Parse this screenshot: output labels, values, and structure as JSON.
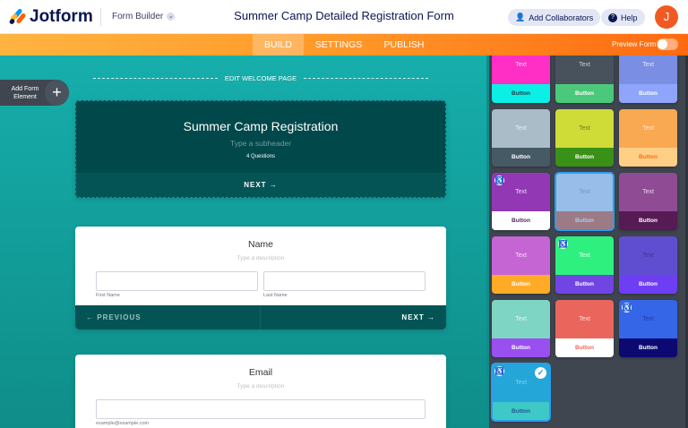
{
  "header": {
    "logo": "Jotform",
    "builder_label": "Form Builder",
    "form_title": "Summer Camp Detailed Registration Form",
    "add_collaborators": "Add Collaborators",
    "help": "Help",
    "avatar_initial": "J"
  },
  "nav": {
    "tabs": [
      {
        "label": "BUILD"
      },
      {
        "label": "SETTINGS"
      },
      {
        "label": "PUBLISH"
      }
    ],
    "active_tab": "BUILD",
    "preview_label": "Preview Form",
    "preview_on": false
  },
  "canvas": {
    "add_element": "Add Form Element",
    "add_icon": "+",
    "edit_welcome": "EDIT WELCOME PAGE",
    "welcome": {
      "title": "Summer Camp Registration",
      "subheader": "Type a subheader",
      "questions": "4 Questions",
      "next": "NEXT"
    },
    "name_q": {
      "title": "Name",
      "description": "Type a description",
      "first": "First Name",
      "last": "Last Name",
      "previous": "PREVIOUS",
      "next": "NEXT"
    },
    "email_q": {
      "title": "Email",
      "description": "Type a description",
      "sublabel": "example@example.com"
    }
  },
  "themes": [
    {
      "text": "Text",
      "button": "Button",
      "top": "#ff2ec4",
      "tc": "#ffd6f3",
      "btn": "#0bf0e6",
      "bc": "#1e3a4a"
    },
    {
      "text": "Text",
      "button": "Button",
      "top": "#48525c",
      "tc": "#c9ced4",
      "btn": "#4bc97b",
      "bc": "#ffffff"
    },
    {
      "text": "Text",
      "button": "Button",
      "top": "#7a8ee3",
      "tc": "#e3e8ff",
      "btn": "#8fa5fb",
      "bc": "#ffffff"
    },
    {
      "text": "Text",
      "button": "Button",
      "top": "#a9bcc7",
      "tc": "#e6eef2",
      "btn": "#465a66",
      "bc": "#ffffff"
    },
    {
      "text": "Text",
      "button": "Button",
      "top": "#cfdc38",
      "tc": "#6f7d20",
      "btn": "#3a9117",
      "bc": "#ffffff"
    },
    {
      "text": "Text",
      "button": "Button",
      "top": "#f8a952",
      "tc": "#ffe8cc",
      "btn": "#ffcf85",
      "bc": "#f56e1c"
    },
    {
      "text": "Text",
      "button": "Button",
      "top": "#9238b5",
      "tc": "#ecd6f5",
      "btn": "#ffffff",
      "bc": "#552266",
      "accessible": true
    },
    {
      "text": "Text",
      "button": "Button",
      "top": "#98bde8",
      "tc": "#7a96b8",
      "btn": "#9c7b87",
      "bc": "#a8cfee",
      "selected": true
    },
    {
      "text": "Text",
      "button": "Button",
      "top": "#8f4b94",
      "tc": "#ecd3ee",
      "btn": "#561a54",
      "bc": "#ffffff"
    },
    {
      "text": "Text",
      "button": "Button",
      "top": "#c565d3",
      "tc": "#f6dcfa",
      "btn": "#ffab26",
      "bc": "#ffffff"
    },
    {
      "text": "Text",
      "button": "Button",
      "top": "#2ef07f",
      "tc": "#e6fff0",
      "btn": "#7045e3",
      "bc": "#ffffff",
      "accessible": true
    },
    {
      "text": "Text",
      "button": "Button",
      "top": "#5f4fd0",
      "tc": "#3e3498",
      "btn": "#6e3ef5",
      "bc": "#ffffff"
    },
    {
      "text": "Text",
      "button": "Button",
      "top": "#7fd5c3",
      "tc": "#e3f7f2",
      "btn": "#9a4ff0",
      "bc": "#ffffff"
    },
    {
      "text": "Text",
      "button": "Button",
      "top": "#ea665c",
      "tc": "#ffe1de",
      "btn": "#ffffff",
      "bc": "#ea665c"
    },
    {
      "text": "Text",
      "button": "Button",
      "top": "#3566e7",
      "tc": "#1e3aa8",
      "btn": "#0c0a72",
      "bc": "#ffffff",
      "accessible": true
    },
    {
      "text": "Text",
      "button": "Button",
      "top": "#25a6d9",
      "tc": "#7dd0f0",
      "btn": "#3ec8c8",
      "bc": "#1d5a8a",
      "accessible": true,
      "checked": true,
      "selected": true
    }
  ]
}
